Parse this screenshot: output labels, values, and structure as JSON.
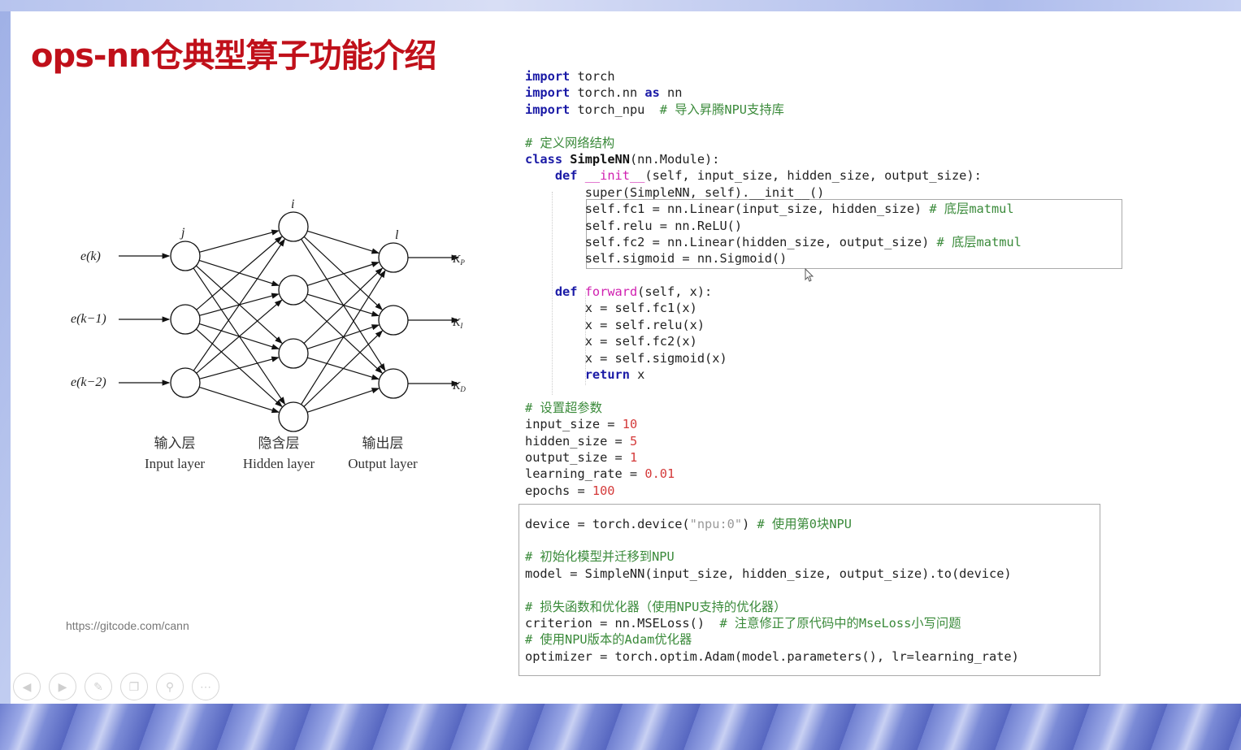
{
  "slide": {
    "title": "ops-nn仓典型算子功能介绍",
    "url": "https://gitcode.com/cann"
  },
  "diagram": {
    "inputs": [
      "e(k)",
      "e(k−1)",
      "e(k−2)"
    ],
    "outputs": [
      "K_P",
      "K_I",
      "K_D"
    ],
    "index_labels": {
      "input": "j",
      "hidden": "i",
      "output": "l"
    },
    "layers": [
      {
        "cn": "输入层",
        "en": "Input layer"
      },
      {
        "cn": "隐含层",
        "en": "Hidden layer"
      },
      {
        "cn": "输出层",
        "en": "Output layer"
      }
    ]
  },
  "code": {
    "l1_kw": "import",
    "l1": " torch",
    "l2_kw": "import",
    "l2a": " torch.nn ",
    "l2_kw2": "as",
    "l2b": " nn",
    "l3_kw": "import",
    "l3": " torch_npu  ",
    "l3_cm": "# 导入昇腾NPU支持库",
    "l5_cm": "# 定义网络结构",
    "l6_kw": "class",
    "l6_cls": " SimpleNN",
    "l6": "(nn.Module):",
    "l7_kw": "def",
    "l7_fn": " __init__",
    "l7": "(self, input_size, hidden_size, output_size):",
    "l8": "super(SimpleNN, self).__init__()",
    "l9": "self.fc1 = nn.Linear(input_size, hidden_size) ",
    "l9_cm": "# 底层matmul",
    "l10": "self.relu = nn.ReLU()",
    "l11": "self.fc2 = nn.Linear(hidden_size, output_size) ",
    "l11_cm": "# 底层matmul",
    "l12": "self.sigmoid = nn.Sigmoid()",
    "l14_kw": "def",
    "l14_fn": " forward",
    "l14": "(self, x):",
    "l15": "x = self.fc1(x)",
    "l16": "x = self.relu(x)",
    "l17": "x = self.fc2(x)",
    "l18": "x = self.sigmoid(x)",
    "l19_kw": "return",
    "l19": " x",
    "l21_cm": "# 设置超参数",
    "l22": "input_size = ",
    "l22_n": "10",
    "l23": "hidden_size = ",
    "l23_n": "5",
    "l24": "output_size = ",
    "l24_n": "1",
    "l25": "learning_rate = ",
    "l25_n": "0.01",
    "l26": "epochs = ",
    "l26_n": "100",
    "l28a": "device = torch.device(",
    "l28_s": "\"npu:0\"",
    "l28b": ") ",
    "l28_cm": "# 使用第0块NPU",
    "l30_cm": "# 初始化模型并迁移到NPU",
    "l31": "model = SimpleNN(input_size, hidden_size, output_size).to(device)",
    "l33_cm": "# 损失函数和优化器（使用NPU支持的优化器）",
    "l34": "criterion = nn.MSELoss()  ",
    "l34_cm": "# 注意修正了原代码中的MseLoss小写问题",
    "l35_cm": "# 使用NPU版本的Adam优化器",
    "l36": "optimizer = torch.optim.Adam(model.parameters(), lr=learning_rate)"
  },
  "toolbar": {
    "icons": [
      "prev-icon",
      "next-icon",
      "pen-icon",
      "slides-icon",
      "zoom-icon",
      "more-icon"
    ]
  }
}
